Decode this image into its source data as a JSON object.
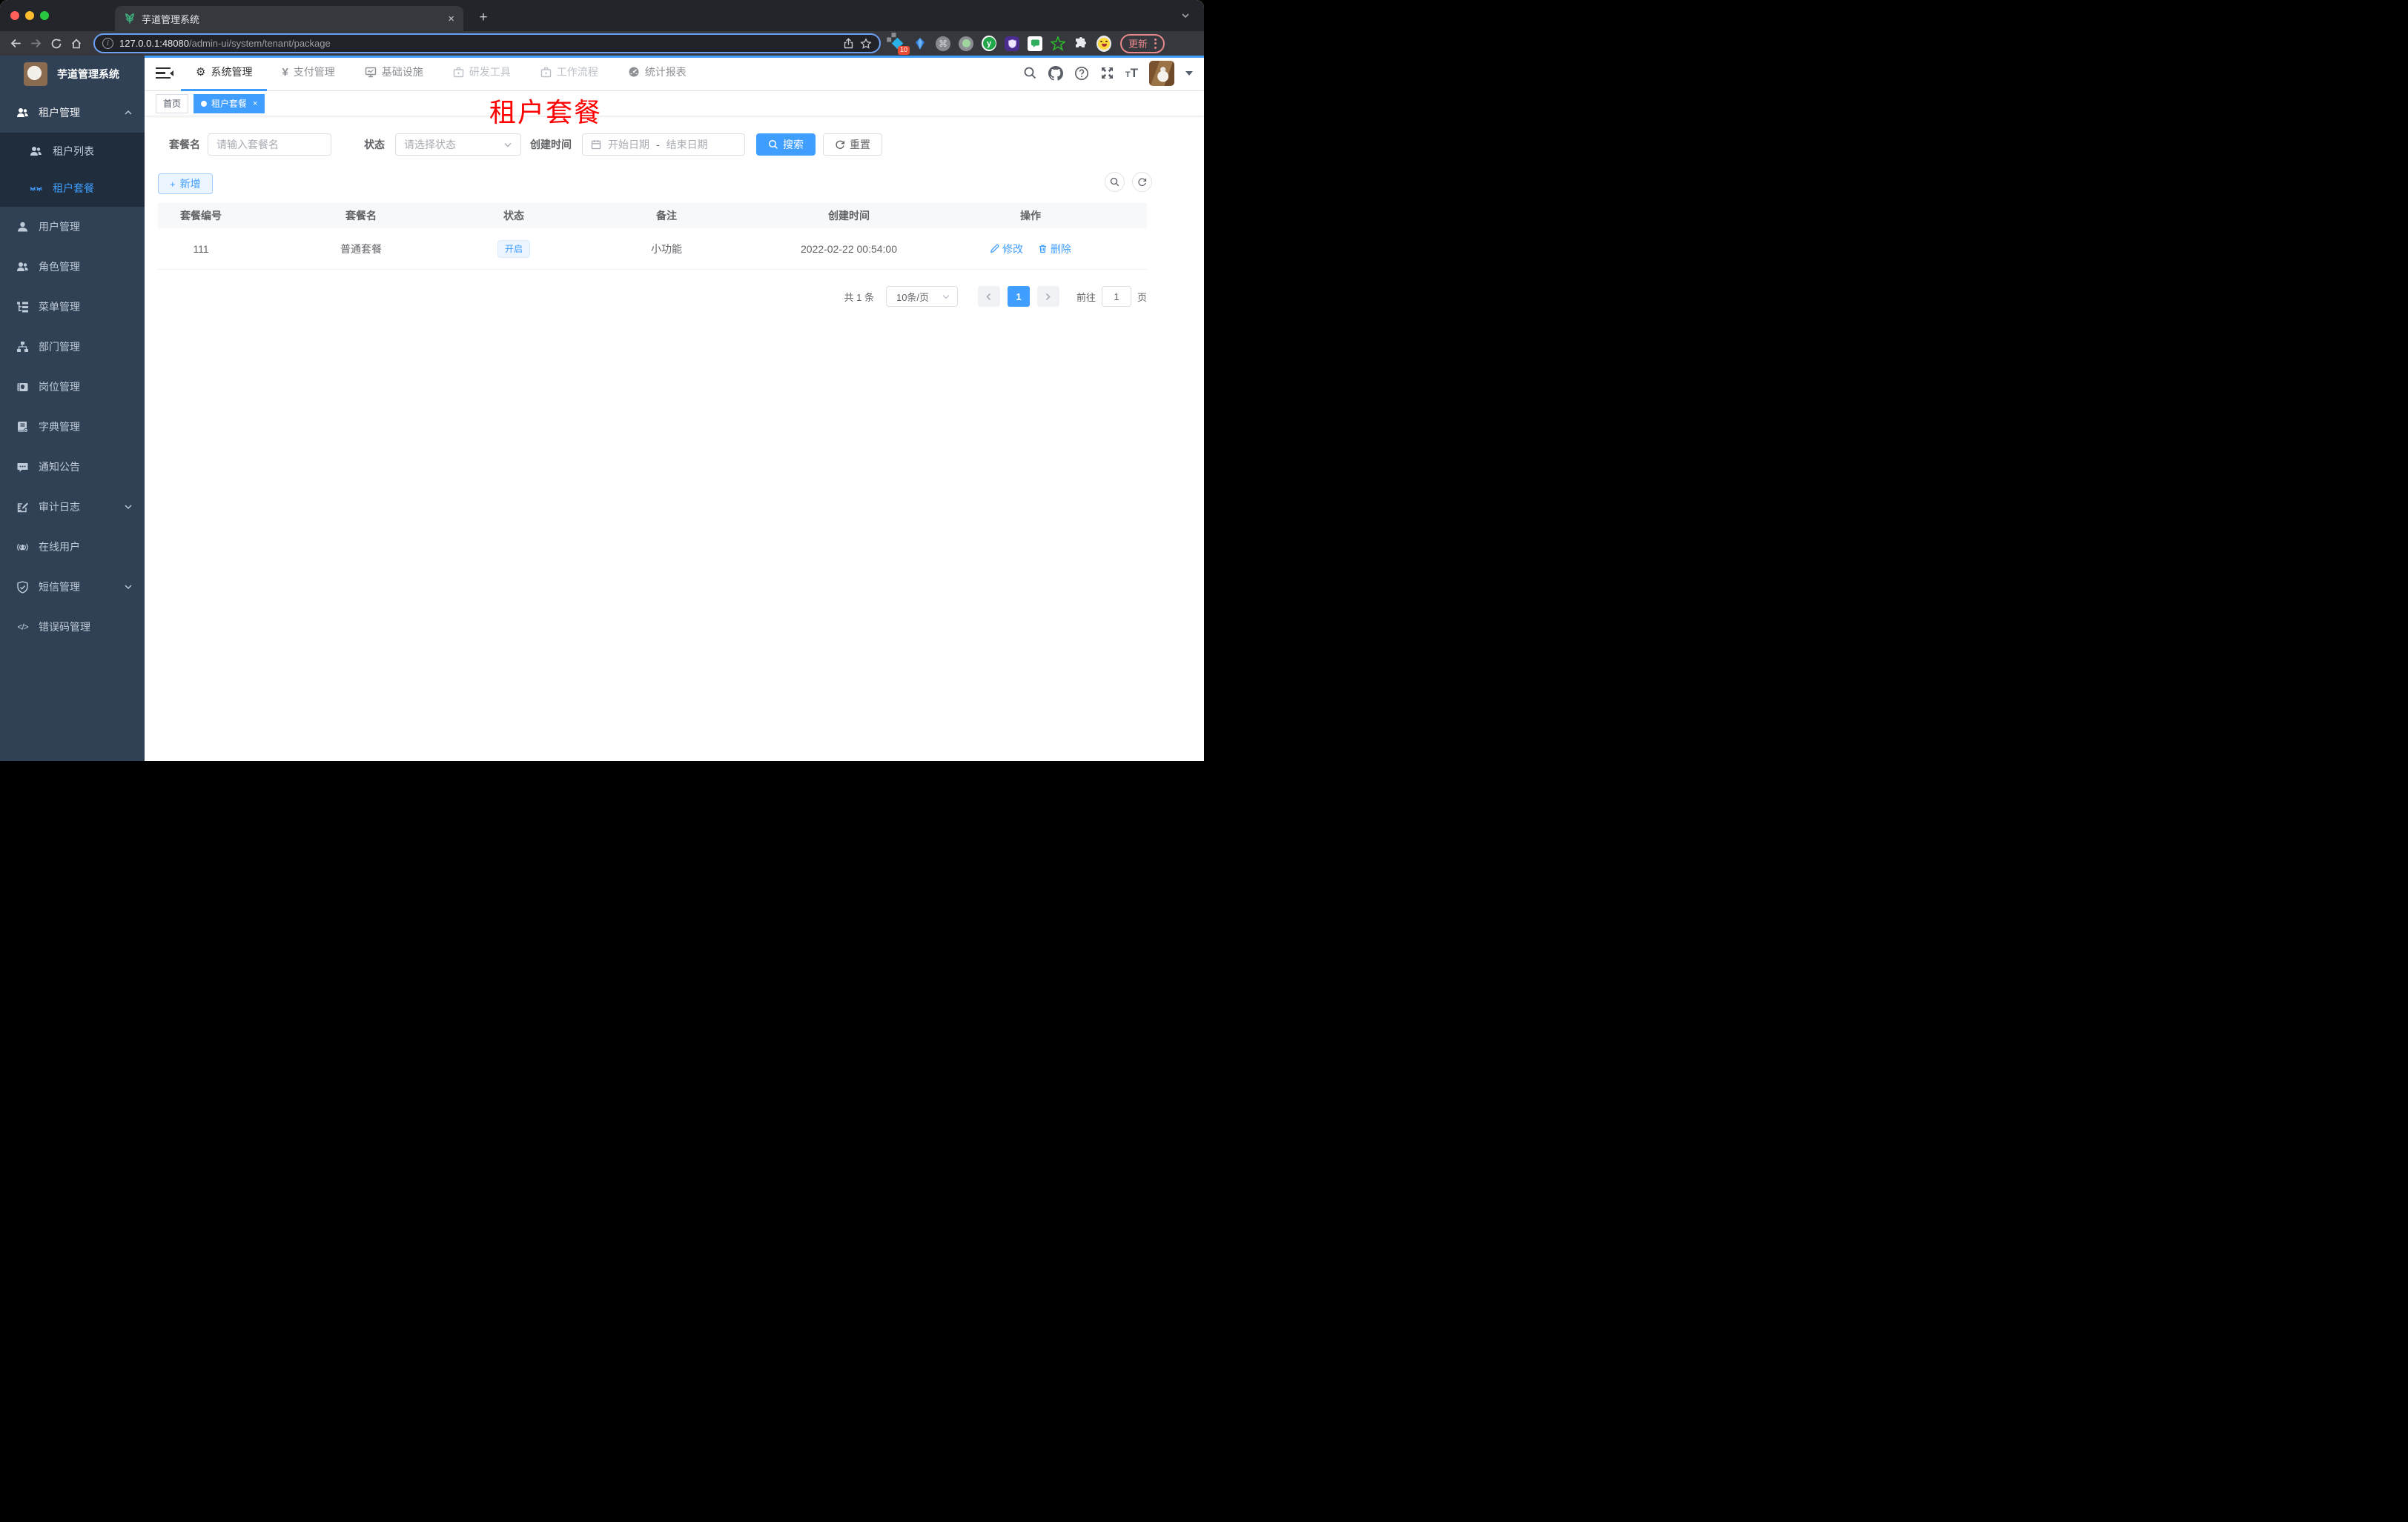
{
  "colors": {
    "primary": "#409eff",
    "sidebar_bg": "#304156",
    "submenu_bg": "#1f2d3d",
    "annotation_red": "#fe0000",
    "tag_active": "#409eff"
  },
  "icons": {
    "close": "×",
    "new_tab": "+",
    "command": "⌘",
    "ext_y": "y",
    "info": "i",
    "question": "?",
    "font_small": "T",
    "font_big": "T",
    "yen": "¥",
    "gear": "⚙",
    "code": "</>",
    "separator": "-"
  },
  "browser": {
    "tab_title": "芋道管理系统",
    "url_host": "127.0.0.1:48080",
    "url_path": "/admin-ui/system/tenant/package",
    "ext_badge": "10",
    "update_label": "更新"
  },
  "app": {
    "sidebar": {
      "title": "芋道管理系统",
      "tenant_parent": "租户管理",
      "tenant_list": "租户列表",
      "tenant_package": "租户套餐",
      "items": [
        "用户管理",
        "角色管理",
        "菜单管理",
        "部门管理",
        "岗位管理",
        "字典管理",
        "通知公告",
        "审计日志",
        "在线用户",
        "短信管理",
        "错误码管理"
      ]
    },
    "topnav": {
      "items": [
        "系统管理",
        "支付管理",
        "基础设施",
        "研发工具",
        "工作流程",
        "统计报表"
      ]
    },
    "tags": {
      "home": "首页",
      "active": "租户套餐"
    },
    "annotation": "租户套餐",
    "filter": {
      "name_label": "套餐名",
      "name_placeholder": "请输入套餐名",
      "status_label": "状态",
      "status_placeholder": "请选择状态",
      "time_label": "创建时间",
      "start_placeholder": "开始日期",
      "end_placeholder": "结束日期",
      "search_label": "搜索",
      "reset_label": "重置"
    },
    "toolbar": {
      "add_label": "新增"
    },
    "table": {
      "headers": [
        "套餐编号",
        "套餐名",
        "状态",
        "备注",
        "创建时间",
        "操作"
      ],
      "rows": [
        {
          "id": "111",
          "name": "普通套餐",
          "status": "开启",
          "remark": "小功能",
          "create_time": "2022-02-22 00:54:00"
        }
      ],
      "actions": {
        "edit": "修改",
        "delete": "删除"
      }
    },
    "pagination": {
      "total": "共 1 条",
      "page_size": "10条/页",
      "page": "1",
      "goto_label": "前往",
      "goto_value": "1",
      "unit_label": "页"
    }
  }
}
